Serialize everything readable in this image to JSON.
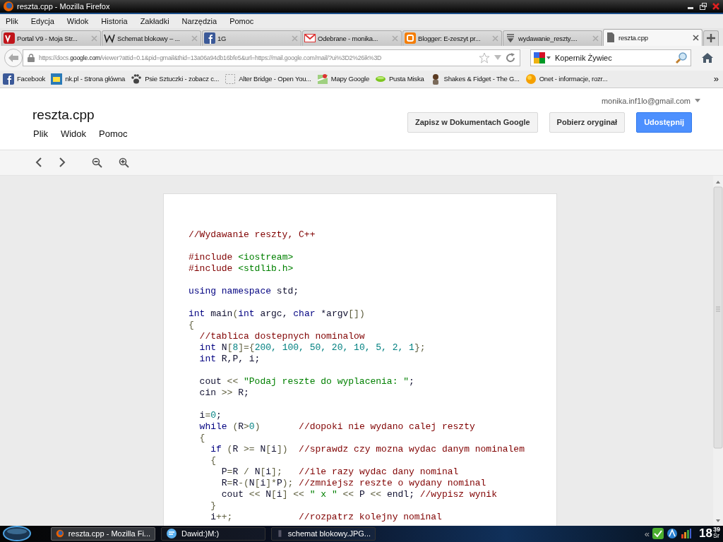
{
  "window": {
    "title": "reszta.cpp - Mozilla Firefox"
  },
  "menu": [
    "Plik",
    "Edycja",
    "Widok",
    "Historia",
    "Zakładki",
    "Narzędzia",
    "Pomoc"
  ],
  "tabs": [
    {
      "label": "Portal V9 - Moja Str...",
      "kind": "v9",
      "selected": false
    },
    {
      "label": "Schemat blokowy – ...",
      "kind": "wiki",
      "selected": false
    },
    {
      "label": "1G",
      "kind": "facebook",
      "selected": false
    },
    {
      "label": "Odebrane - monika...",
      "kind": "gmail",
      "selected": false
    },
    {
      "label": "Blogger: E-zeszyt pr...",
      "kind": "blogger",
      "selected": false
    },
    {
      "label": "wydawanie_reszty....",
      "kind": "list",
      "selected": false
    },
    {
      "label": "reszta.cpp",
      "kind": "file",
      "selected": true
    }
  ],
  "address": {
    "prefix": "https://docs.",
    "domain": "google.com",
    "rest": "/viewer?attid=0.1&pid=gmail&thid=13a06a94db16bfe5&url=https://mail.google.com/mail/?ui%3D2%26ik%3D"
  },
  "search": {
    "value": "Kopernik Żywiec"
  },
  "bookmarks": [
    {
      "label": "Facebook",
      "kind": "facebook"
    },
    {
      "label": "nk.pl - Strona główna",
      "kind": "nk"
    },
    {
      "label": "Psie Sztuczki - zobacz c...",
      "kind": "paw"
    },
    {
      "label": "Alter Bridge - Open You...",
      "kind": "blank"
    },
    {
      "label": "Mapy Google",
      "kind": "map"
    },
    {
      "label": "Pusta Miska",
      "kind": "bowl"
    },
    {
      "label": "Shakes & Fidget - The G...",
      "kind": "figure"
    },
    {
      "label": "Onet - informacje, rozr...",
      "kind": "orange"
    }
  ],
  "bookmarks_more": "»",
  "viewer": {
    "title": "reszta.cpp",
    "menus": [
      "Plik",
      "Widok",
      "Pomoc"
    ],
    "account": "monika.inf1lo@gmail.com",
    "buttons": [
      {
        "label": "Zapisz w Dokumentach Google",
        "primary": false
      },
      {
        "label": "Pobierz oryginał",
        "primary": false
      },
      {
        "label": "Udostępnij",
        "primary": true
      }
    ]
  },
  "code": {
    "blocks": [
      {
        "lines": [
          {
            "tokens": [
              {
                "kind": "comment",
                "text": "//Wydawanie reszty, C++"
              }
            ]
          }
        ]
      },
      {
        "lines": [
          {
            "tokens": [
              {
                "kind": "directive",
                "text": "#include "
              },
              {
                "kind": "header",
                "text": "<iostream>"
              }
            ]
          },
          {
            "tokens": [
              {
                "kind": "directive",
                "text": "#include "
              },
              {
                "kind": "header",
                "text": "<stdlib.h>"
              }
            ]
          }
        ]
      },
      {
        "lines": [
          {
            "tokens": [
              {
                "kind": "keyword",
                "text": "using namespace "
              },
              {
                "kind": "plain",
                "text": "std;"
              }
            ]
          }
        ]
      },
      {
        "lines": [
          {
            "tokens": [
              {
                "kind": "keyword",
                "text": "int "
              },
              {
                "kind": "plain",
                "text": "main"
              },
              {
                "kind": "operator",
                "text": "("
              },
              {
                "kind": "keyword",
                "text": "int "
              },
              {
                "kind": "plain",
                "text": "argc, "
              },
              {
                "kind": "keyword",
                "text": "char "
              },
              {
                "kind": "plain",
                "text": "*argv"
              },
              {
                "kind": "operator",
                "text": "[])"
              }
            ]
          },
          {
            "tokens": [
              {
                "kind": "operator",
                "text": "{"
              }
            ]
          },
          {
            "tokens": [
              {
                "kind": "comment",
                "text": "  //tablica dostepnych nominalow"
              }
            ]
          },
          {
            "tokens": [
              {
                "kind": "keyword",
                "text": "  int "
              },
              {
                "kind": "plain",
                "text": "N"
              },
              {
                "kind": "operator",
                "text": "["
              },
              {
                "kind": "number",
                "text": "8"
              },
              {
                "kind": "operator",
                "text": "]={"
              },
              {
                "kind": "number",
                "text": "200, 100, 50, 20, 10, 5, 2, 1"
              },
              {
                "kind": "operator",
                "text": "};"
              }
            ]
          },
          {
            "tokens": [
              {
                "kind": "keyword",
                "text": "  int "
              },
              {
                "kind": "plain",
                "text": "R,P, i;"
              }
            ]
          }
        ]
      },
      {
        "lines": [
          {
            "tokens": [
              {
                "kind": "plain",
                "text": "  cout "
              },
              {
                "kind": "operator",
                "text": "<< "
              },
              {
                "kind": "string",
                "text": "\"Podaj reszte do wyplacenia: \""
              },
              {
                "kind": "plain",
                "text": ";"
              }
            ]
          },
          {
            "tokens": [
              {
                "kind": "plain",
                "text": "  cin "
              },
              {
                "kind": "operator",
                "text": ">> "
              },
              {
                "kind": "plain",
                "text": "R;"
              }
            ]
          }
        ]
      },
      {
        "lines": [
          {
            "tokens": [
              {
                "kind": "plain",
                "text": "  i"
              },
              {
                "kind": "operator",
                "text": "="
              },
              {
                "kind": "number",
                "text": "0"
              },
              {
                "kind": "plain",
                "text": ";"
              }
            ]
          },
          {
            "tokens": [
              {
                "kind": "keyword",
                "text": "  while "
              },
              {
                "kind": "operator",
                "text": "("
              },
              {
                "kind": "plain",
                "text": "R"
              },
              {
                "kind": "operator",
                "text": ">"
              },
              {
                "kind": "number",
                "text": "0"
              },
              {
                "kind": "operator",
                "text": ")"
              },
              {
                "kind": "comment",
                "text": "       //dopoki nie wydano calej reszty"
              }
            ]
          },
          {
            "tokens": [
              {
                "kind": "operator",
                "text": "  {"
              }
            ]
          },
          {
            "tokens": [
              {
                "kind": "keyword",
                "text": "    if "
              },
              {
                "kind": "operator",
                "text": "("
              },
              {
                "kind": "plain",
                "text": "R "
              },
              {
                "kind": "operator",
                "text": ">= "
              },
              {
                "kind": "plain",
                "text": "N"
              },
              {
                "kind": "operator",
                "text": "["
              },
              {
                "kind": "plain",
                "text": "i"
              },
              {
                "kind": "operator",
                "text": "])"
              },
              {
                "kind": "comment",
                "text": "  //sprawdz czy mozna wydac danym nominalem"
              }
            ]
          },
          {
            "tokens": [
              {
                "kind": "operator",
                "text": "    {"
              }
            ]
          },
          {
            "tokens": [
              {
                "kind": "plain",
                "text": "      P"
              },
              {
                "kind": "operator",
                "text": "="
              },
              {
                "kind": "plain",
                "text": "R "
              },
              {
                "kind": "operator",
                "text": "/ "
              },
              {
                "kind": "plain",
                "text": "N"
              },
              {
                "kind": "operator",
                "text": "["
              },
              {
                "kind": "plain",
                "text": "i"
              },
              {
                "kind": "operator",
                "text": "];"
              },
              {
                "kind": "comment",
                "text": "   //ile razy wydac dany nominal"
              }
            ]
          },
          {
            "tokens": [
              {
                "kind": "plain",
                "text": "      R"
              },
              {
                "kind": "operator",
                "text": "="
              },
              {
                "kind": "plain",
                "text": "R"
              },
              {
                "kind": "operator",
                "text": "-("
              },
              {
                "kind": "plain",
                "text": "N"
              },
              {
                "kind": "operator",
                "text": "["
              },
              {
                "kind": "plain",
                "text": "i"
              },
              {
                "kind": "operator",
                "text": "]*"
              },
              {
                "kind": "plain",
                "text": "P"
              },
              {
                "kind": "operator",
                "text": ");"
              },
              {
                "kind": "comment",
                "text": " //zmniejsz reszte o wydany nominal"
              }
            ]
          },
          {
            "tokens": [
              {
                "kind": "plain",
                "text": "      cout "
              },
              {
                "kind": "operator",
                "text": "<< "
              },
              {
                "kind": "plain",
                "text": "N"
              },
              {
                "kind": "operator",
                "text": "["
              },
              {
                "kind": "plain",
                "text": "i"
              },
              {
                "kind": "operator",
                "text": "] << "
              },
              {
                "kind": "string",
                "text": "\" x \""
              },
              {
                "kind": "operator",
                "text": " << "
              },
              {
                "kind": "plain",
                "text": "P "
              },
              {
                "kind": "operator",
                "text": "<< "
              },
              {
                "kind": "plain",
                "text": "endl; "
              },
              {
                "kind": "comment",
                "text": "//wypisz wynik"
              }
            ]
          },
          {
            "tokens": [
              {
                "kind": "operator",
                "text": "    }"
              }
            ]
          },
          {
            "tokens": [
              {
                "kind": "plain",
                "text": "    i"
              },
              {
                "kind": "operator",
                "text": "++;"
              },
              {
                "kind": "comment",
                "text": "            //rozpatrz kolejny nominal"
              }
            ]
          }
        ]
      }
    ]
  },
  "taskbar": {
    "items": [
      {
        "label": "reszta.cpp - Mozilla Fi...",
        "kind": "firefox",
        "selected": true
      },
      {
        "label": "Dawid:)M:)",
        "kind": "chat",
        "selected": false
      },
      {
        "label": "schemat blokowy.JPG...",
        "kind": "image",
        "selected": false
      }
    ],
    "clock": {
      "hour": "18",
      "minute": "39",
      "day": "Śr"
    },
    "tray_more": "«"
  }
}
